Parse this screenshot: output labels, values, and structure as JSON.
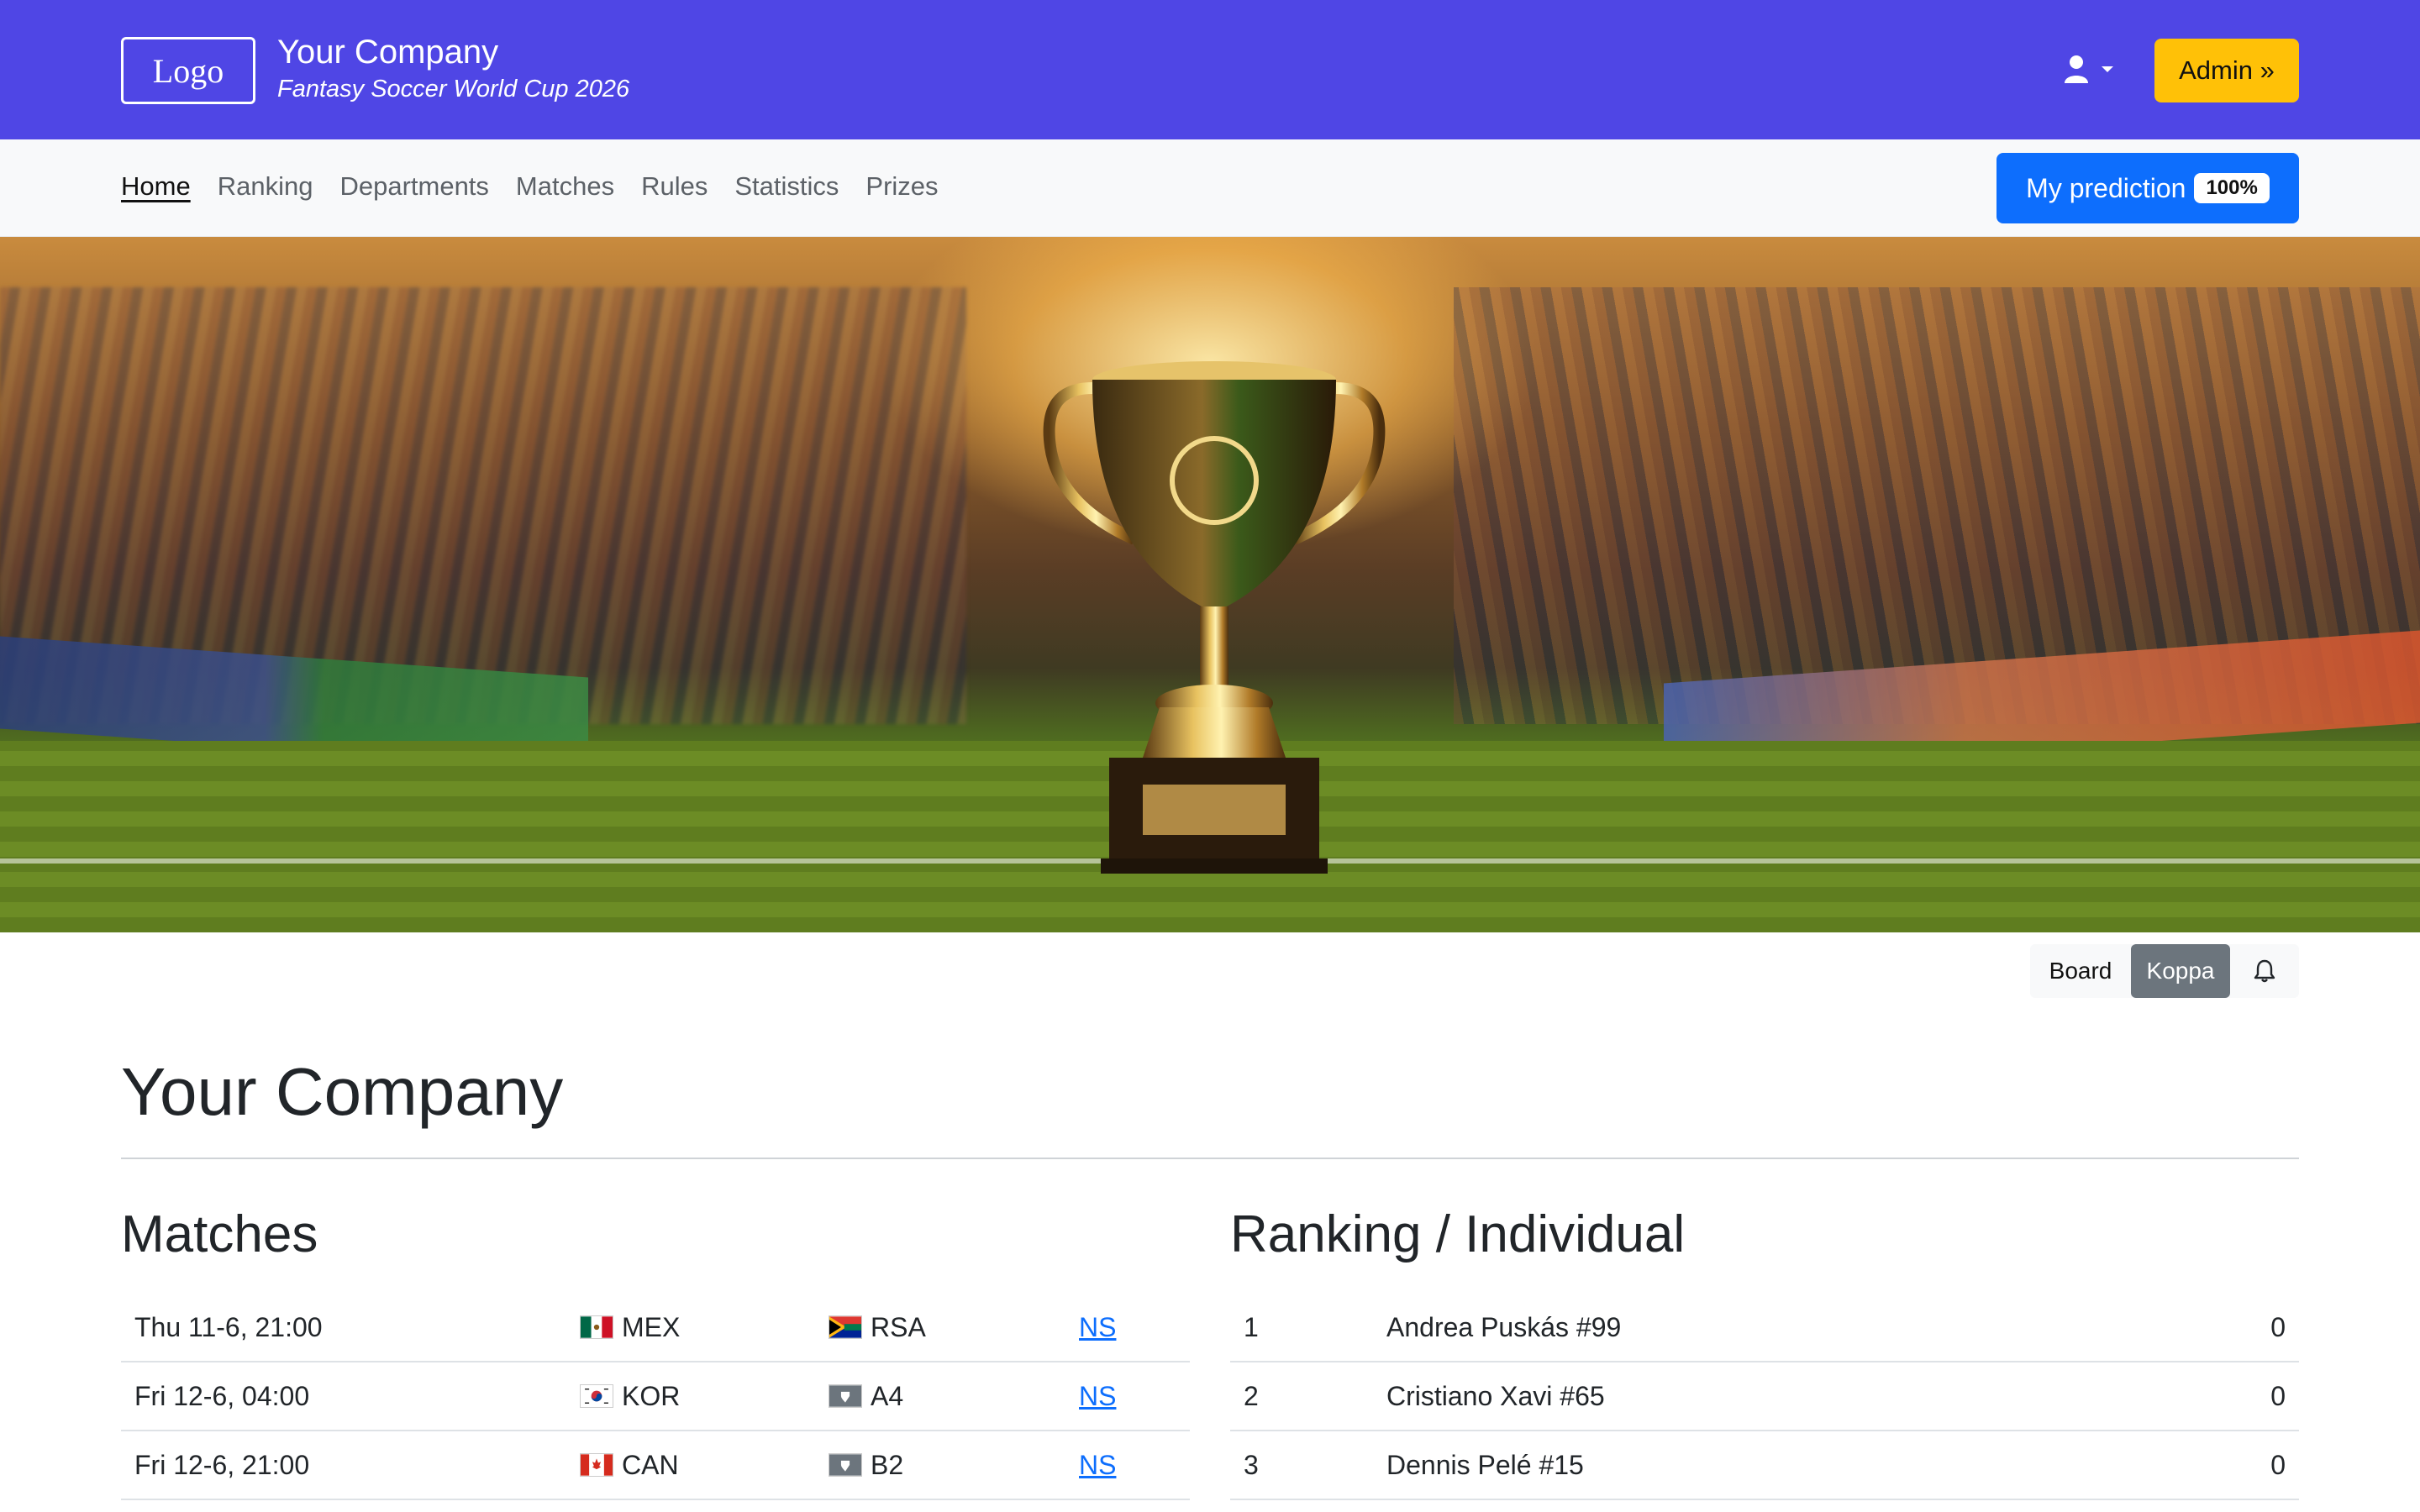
{
  "header": {
    "logo_text": "Logo",
    "company_name": "Your Company",
    "subtitle": "Fantasy Soccer World Cup 2026",
    "user_icon": "user-icon",
    "admin_label": "Admin »"
  },
  "nav": {
    "items": [
      "Home",
      "Ranking",
      "Departments",
      "Matches",
      "Rules",
      "Statistics",
      "Prizes"
    ],
    "active": "Home",
    "prediction_label": "My prediction",
    "prediction_badge": "100%"
  },
  "board_toggle": {
    "board_label": "Board",
    "koppa_label": "Koppa",
    "bell_icon": "bell-icon"
  },
  "page_title": "Your Company",
  "matches": {
    "title": "Matches",
    "rows": [
      {
        "date": "Thu 11-6, 21:00",
        "home": "MEX",
        "home_flag": "mexico-flag",
        "away": "RSA",
        "away_flag": "south-africa-flag",
        "status": "NS"
      },
      {
        "date": "Fri 12-6, 04:00",
        "home": "KOR",
        "home_flag": "south-korea-flag",
        "away": "A4",
        "away_flag": "placeholder-flag",
        "status": "NS"
      },
      {
        "date": "Fri 12-6, 21:00",
        "home": "CAN",
        "home_flag": "canada-flag",
        "away": "B2",
        "away_flag": "placeholder-flag",
        "status": "NS"
      }
    ]
  },
  "ranking": {
    "title": "Ranking / Individual",
    "rows": [
      {
        "pos": "1",
        "name": "Andrea Puskás #99",
        "points": "0"
      },
      {
        "pos": "2",
        "name": "Cristiano Xavi #65",
        "points": "0"
      },
      {
        "pos": "3",
        "name": "Dennis Pelé #15",
        "points": "0"
      }
    ]
  },
  "colors": {
    "header_bg": "#4f46e5",
    "admin_btn": "#ffc107",
    "primary": "#0d6efd",
    "toggle_active": "#6c757d"
  }
}
